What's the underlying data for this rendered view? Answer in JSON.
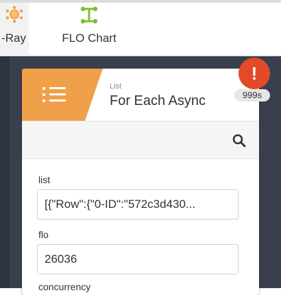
{
  "toolbar": {
    "tools": [
      {
        "label": "-Ray",
        "icon": "xray-icon",
        "color": "#f0a049"
      },
      {
        "label": "FLO Chart",
        "icon": "flo-chart-icon",
        "color": "#7dbf2a"
      }
    ]
  },
  "panel": {
    "kicker": "List",
    "title": "For Each Async",
    "accent_color": "#f0a049",
    "alert": {
      "symbol": "!",
      "count": "999s",
      "color": "#e24a2a"
    },
    "search_icon": "search-icon",
    "fields": [
      {
        "label": "list",
        "value": "[{\"Row\":{\"0-ID\":\"572c3d430..."
      },
      {
        "label": "flo",
        "value": "26036"
      },
      {
        "label": "concurrency",
        "value": ""
      }
    ]
  }
}
